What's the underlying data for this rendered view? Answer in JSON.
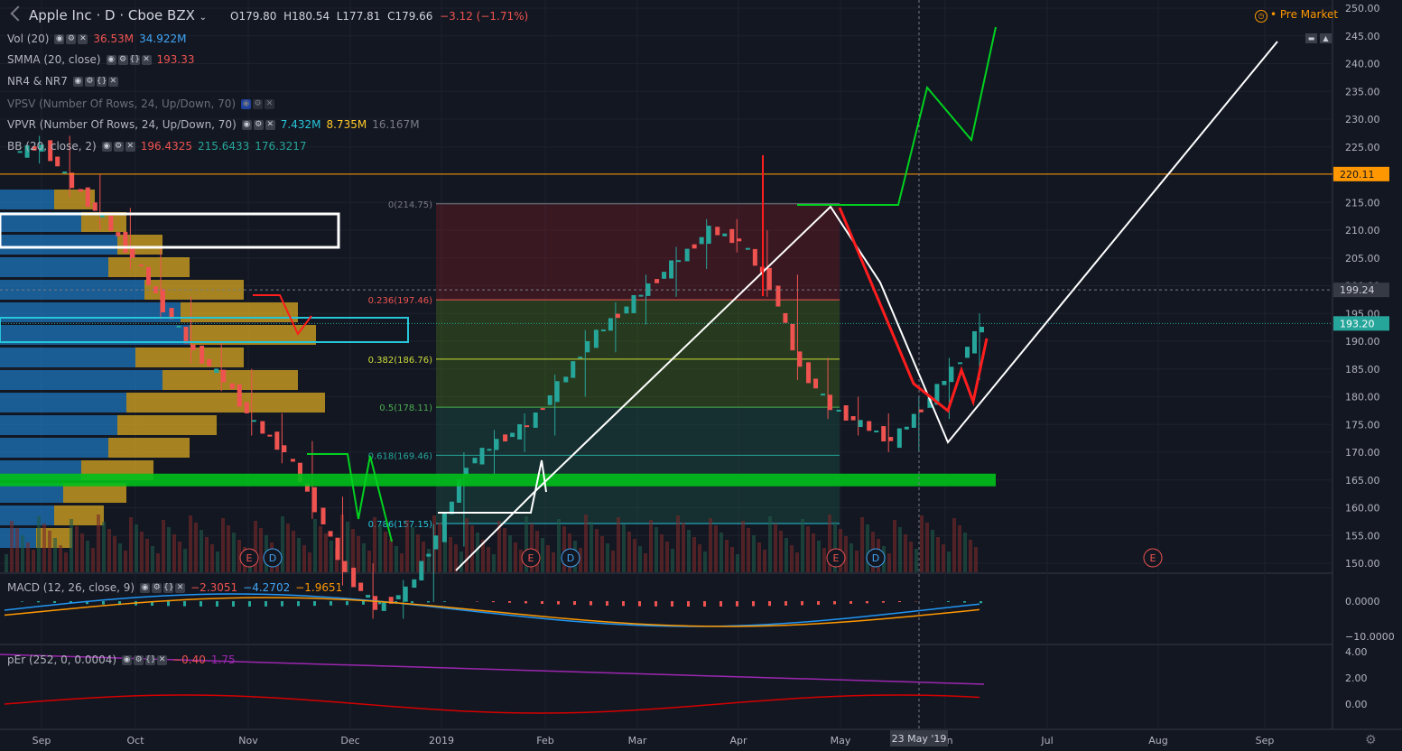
{
  "header": {
    "symbol": "Apple Inc",
    "interval": "D",
    "exchange": "Cboe BZX",
    "open": "O179.80",
    "high": "H180.54",
    "low": "L177.81",
    "close": "C179.66",
    "change": "−3.12 (−1.71%)",
    "premarket": "Pre Market"
  },
  "indicators": {
    "vol": {
      "name": "Vol (20)",
      "v1": "36.53M",
      "v2": "34.922M"
    },
    "smma": {
      "name": "SMMA (20, close)",
      "v1": "193.33"
    },
    "nr": {
      "name": "NR4 & NR7"
    },
    "vpsv": {
      "name": "VPSV (Number Of Rows, 24, Up/Down, 70)"
    },
    "vpvr": {
      "name": "VPVR (Number Of Rows, 24, Up/Down, 70)",
      "v1": "7.432M",
      "v2": "8.735M",
      "v3": "16.167M"
    },
    "bb": {
      "name": "BB (20, close, 2)",
      "v1": "196.4325",
      "v2": "215.6433",
      "v3": "176.3217"
    },
    "macd": {
      "name": "MACD (12, 26, close, 9)",
      "v1": "−2.3051",
      "v2": "−4.2702",
      "v3": "−1.9651"
    },
    "per": {
      "name": "pEr (252, 0, 0.0004)",
      "v1": "−0.40",
      "v2": "1.75"
    }
  },
  "price_axis": {
    "ticks": [
      "250.00",
      "245.00",
      "240.00",
      "235.00",
      "230.00",
      "225.00",
      "220.00",
      "215.00",
      "210.00",
      "205.00",
      "200.00",
      "195.00",
      "190.00",
      "185.00",
      "180.00",
      "175.00",
      "170.00",
      "165.00",
      "160.00",
      "155.00",
      "150.00"
    ],
    "tick_values": [
      250,
      245,
      240,
      235,
      230,
      225,
      220,
      215,
      210,
      205,
      200,
      195,
      190,
      185,
      180,
      175,
      170,
      165,
      160,
      155,
      150
    ],
    "label_220": "220.11",
    "label_199": "199.24",
    "label_193": "193.20"
  },
  "macd_axis": {
    "ticks": [
      "0.0000",
      "−10.0000"
    ]
  },
  "per_axis": {
    "ticks": [
      "4.00",
      "2.00",
      "0.00"
    ]
  },
  "time_axis": {
    "labels": [
      "Sep",
      "Oct",
      "Nov",
      "Dec",
      "2019",
      "Feb",
      "Mar",
      "Apr",
      "May",
      "Jun",
      "Jul",
      "Aug",
      "Sep"
    ],
    "crosshair_label": "23 May '19"
  },
  "fib": {
    "l0": "0(214.75)",
    "l236": "0.236(197.46)",
    "l382": "0.382(186.76)",
    "l5": "0.5(178.11)",
    "l618": "0.618(169.46)",
    "l786": "0.786(157.15)"
  },
  "events": [
    {
      "label": "E"
    },
    {
      "label": "D"
    },
    {
      "label": "E"
    },
    {
      "label": "D"
    },
    {
      "label": "E"
    },
    {
      "label": "D"
    },
    {
      "label": "E"
    }
  ],
  "chart_data": {
    "type": "candlestick",
    "title": "Apple Inc · D · Cboe BZX",
    "x_labels": [
      "Sep",
      "Oct",
      "Nov",
      "Dec",
      "2019",
      "Feb",
      "Mar",
      "Apr",
      "May",
      "Jun"
    ],
    "close_approx": [
      224,
      225,
      218,
      212,
      205,
      196,
      188,
      183,
      175,
      170,
      160,
      148,
      142,
      145,
      155,
      168,
      172,
      175,
      182,
      190,
      195,
      200,
      205,
      210,
      208,
      200,
      185,
      178,
      175,
      172,
      178,
      185,
      193
    ],
    "ylim": [
      148,
      251
    ],
    "colors": {
      "up": "#26a69a",
      "down": "#ef5350"
    }
  },
  "colors": {
    "bg": "#131722",
    "green_level": "#00c01a",
    "orange_level": "#ff9800",
    "cyan": "#26c6da",
    "white": "#ffffff"
  }
}
